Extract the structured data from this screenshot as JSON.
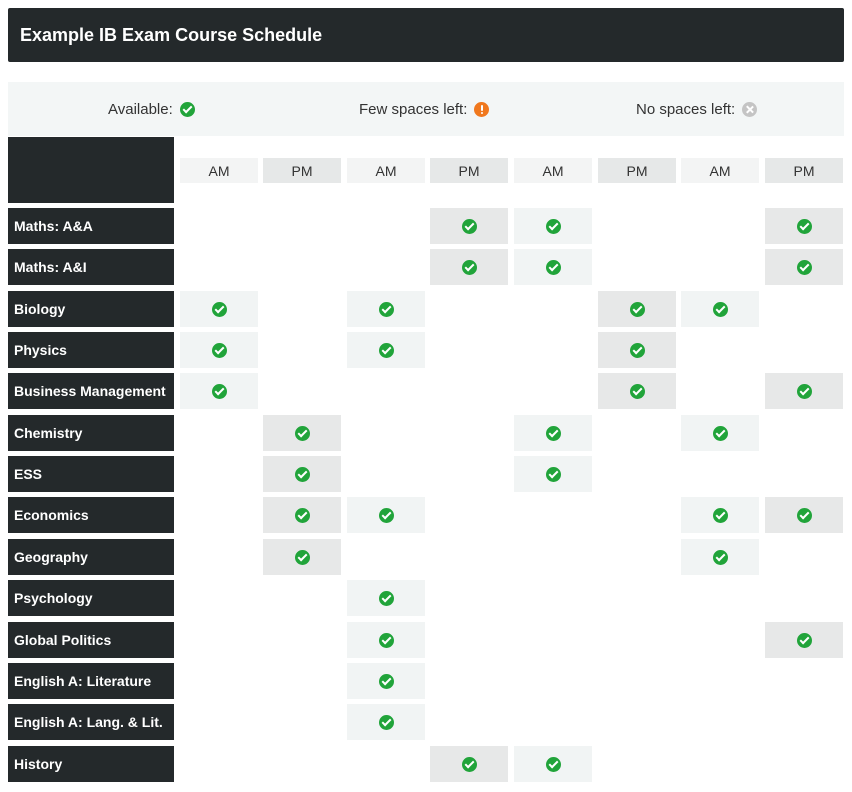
{
  "title": "Example IB Exam Course Schedule",
  "legend": [
    {
      "label": "Available:",
      "icon": "check-circle-icon",
      "status": "available"
    },
    {
      "label": "Few spaces left:",
      "icon": "alert-circle-icon",
      "status": "few"
    },
    {
      "label": "No spaces left:",
      "icon": "x-circle-icon",
      "status": "none"
    }
  ],
  "colors": {
    "available": "#21a43a",
    "few": "#f0781e",
    "none": "#c4c4c4",
    "header_bg": "#24292b"
  },
  "columns": [
    "AM",
    "PM",
    "AM",
    "PM",
    "AM",
    "PM",
    "AM",
    "PM"
  ],
  "rows": [
    {
      "name": "Maths: A&A",
      "slots": [
        0,
        0,
        0,
        1,
        1,
        0,
        0,
        1
      ]
    },
    {
      "name": "Maths: A&I",
      "slots": [
        0,
        0,
        0,
        1,
        1,
        0,
        0,
        1
      ]
    },
    {
      "name": "Biology",
      "slots": [
        1,
        0,
        1,
        0,
        0,
        1,
        1,
        0
      ]
    },
    {
      "name": "Physics",
      "slots": [
        1,
        0,
        1,
        0,
        0,
        1,
        0,
        0
      ]
    },
    {
      "name": "Business Management",
      "slots": [
        1,
        0,
        0,
        0,
        0,
        1,
        0,
        1
      ]
    },
    {
      "name": "Chemistry",
      "slots": [
        0,
        1,
        0,
        0,
        1,
        0,
        1,
        0
      ]
    },
    {
      "name": "ESS",
      "slots": [
        0,
        1,
        0,
        0,
        1,
        0,
        0,
        0
      ]
    },
    {
      "name": "Economics",
      "slots": [
        0,
        1,
        1,
        0,
        0,
        0,
        1,
        1
      ]
    },
    {
      "name": "Geography",
      "slots": [
        0,
        1,
        0,
        0,
        0,
        0,
        1,
        0
      ]
    },
    {
      "name": "Psychology",
      "slots": [
        0,
        0,
        1,
        0,
        0,
        0,
        0,
        0
      ]
    },
    {
      "name": "Global Politics",
      "slots": [
        0,
        0,
        1,
        0,
        0,
        0,
        0,
        1
      ]
    },
    {
      "name": "English A: Literature",
      "slots": [
        0,
        0,
        1,
        0,
        0,
        0,
        0,
        0
      ]
    },
    {
      "name": "English A: Lang. & Lit.",
      "slots": [
        0,
        0,
        1,
        0,
        0,
        0,
        0,
        0
      ]
    },
    {
      "name": "History",
      "slots": [
        0,
        0,
        0,
        1,
        1,
        0,
        0,
        0
      ]
    }
  ]
}
